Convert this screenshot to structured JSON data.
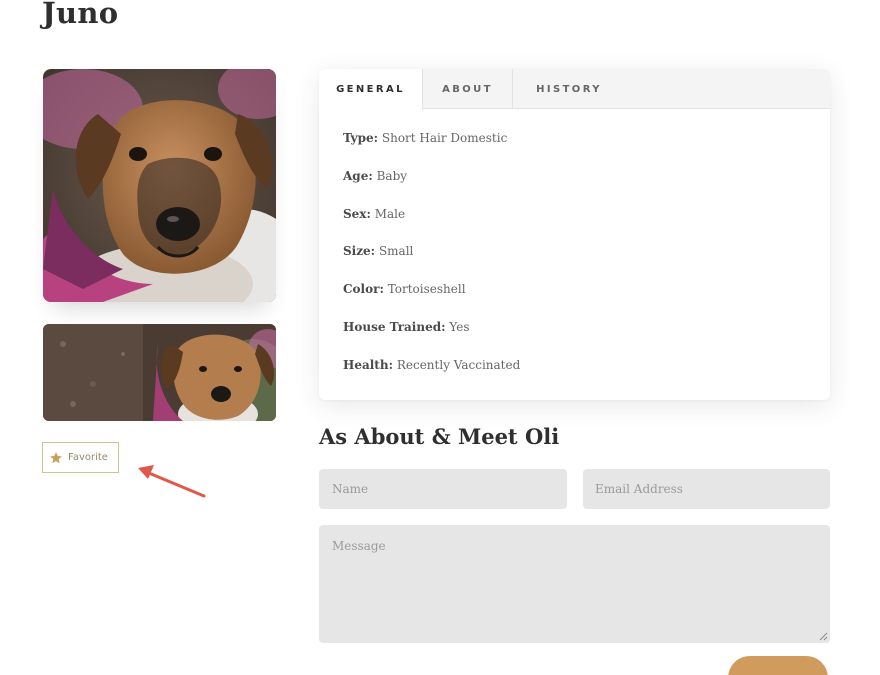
{
  "pet": {
    "name": "Juno"
  },
  "favorite": {
    "label": "Favorite",
    "icon": "star-icon",
    "color": "#c9a05b"
  },
  "tabs": [
    {
      "label": "GENERAL",
      "active": true
    },
    {
      "label": "ABOUT",
      "active": false
    },
    {
      "label": "HISTORY",
      "active": false
    }
  ],
  "details": [
    {
      "key": "Type:",
      "value": "Short Hair Domestic"
    },
    {
      "key": "Age:",
      "value": "Baby"
    },
    {
      "key": "Sex:",
      "value": "Male"
    },
    {
      "key": "Size:",
      "value": "Small"
    },
    {
      "key": "Color:",
      "value": "Tortoiseshell"
    },
    {
      "key": "House Trained:",
      "value": "Yes"
    },
    {
      "key": "Health:",
      "value": "Recently Vaccinated"
    }
  ],
  "contact": {
    "title": "As About & Meet Oli",
    "name_placeholder": "Name",
    "email_placeholder": "Email Address",
    "message_placeholder": "Message"
  },
  "colors": {
    "accent": "#d29b5e",
    "arrow": "#e0574c",
    "field_bg": "#e6e6e6"
  }
}
